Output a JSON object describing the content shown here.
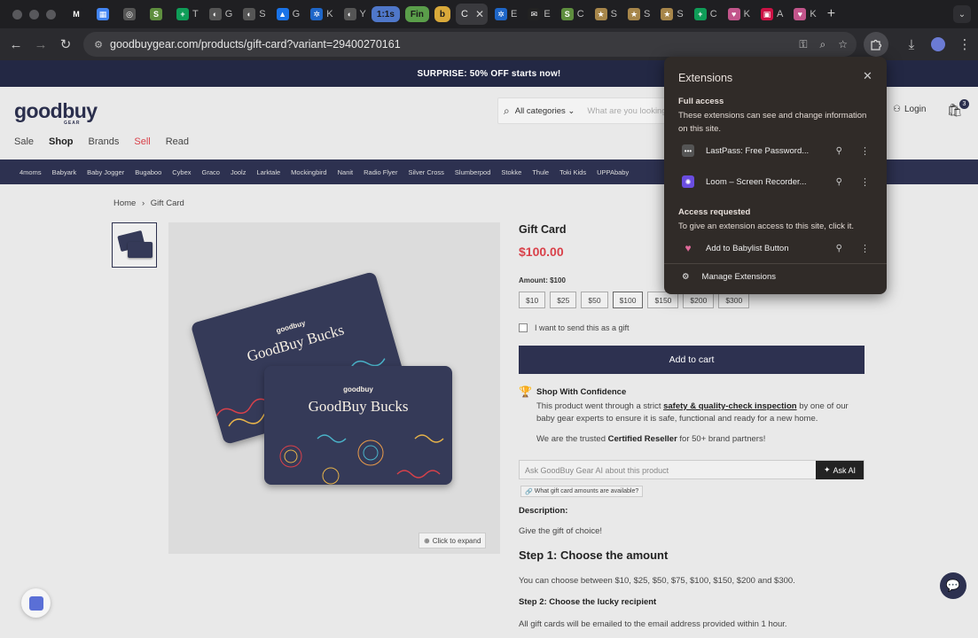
{
  "tabs": [
    {
      "label": "",
      "icon": "gmail-icon",
      "color": "#1f1f22",
      "glyph": "M",
      "active": false
    },
    {
      "label": "",
      "icon": "calendar-icon",
      "color": "#4285f4",
      "glyph": "▦",
      "active": false
    },
    {
      "label": "",
      "icon": "openai-icon",
      "color": "#555",
      "glyph": "◎",
      "active": false
    },
    {
      "label": "",
      "icon": "shopify-icon",
      "color": "#5e8e3e",
      "glyph": "S",
      "active": false
    },
    {
      "label": "T",
      "icon": "sheets-icon",
      "color": "#0f9d58",
      "glyph": "+",
      "active": false
    },
    {
      "label": "G",
      "icon": "github-icon",
      "color": "#555",
      "glyph": "◐",
      "active": false
    },
    {
      "label": "S",
      "icon": "github-icon",
      "color": "#555",
      "glyph": "◐",
      "active": false
    },
    {
      "label": "G",
      "icon": "drive-icon",
      "color": "#1a73e8",
      "glyph": "▲",
      "active": false
    },
    {
      "label": "K",
      "icon": "gear-icon",
      "color": "#1e66c8",
      "glyph": "✲",
      "active": false
    },
    {
      "label": "Y",
      "icon": "github-icon",
      "color": "#555",
      "glyph": "◐",
      "active": false
    },
    {
      "label": "1:1s",
      "icon": "pill",
      "color": "#4f77c9",
      "glyph": "",
      "active": false
    },
    {
      "label": "Fin",
      "icon": "pill",
      "color": "#5a9e4a",
      "glyph": "",
      "active": false
    },
    {
      "label": "b",
      "icon": "pill",
      "color": "#d9a93a",
      "glyph": "",
      "active": false
    },
    {
      "label": "C",
      "icon": "active-tab",
      "color": "#3a3a3e",
      "glyph": "",
      "active": true
    },
    {
      "label": "E",
      "icon": "gear-icon",
      "color": "#1e66c8",
      "glyph": "✲",
      "active": false
    },
    {
      "label": "E",
      "icon": "email-icon",
      "color": "#222",
      "glyph": "✉",
      "active": false
    },
    {
      "label": "C",
      "icon": "shopify-icon",
      "color": "#5e8e3e",
      "glyph": "S",
      "active": false
    },
    {
      "label": "S",
      "icon": "star-icon",
      "color": "#a7864a",
      "glyph": "★",
      "active": false
    },
    {
      "label": "S",
      "icon": "star-icon",
      "color": "#a7864a",
      "glyph": "★",
      "active": false
    },
    {
      "label": "S",
      "icon": "star-icon",
      "color": "#a7864a",
      "glyph": "★",
      "active": false
    },
    {
      "label": "C",
      "icon": "sheets-icon",
      "color": "#0f9d58",
      "glyph": "+",
      "active": false
    },
    {
      "label": "K",
      "icon": "heart-icon",
      "color": "#c2558b",
      "glyph": "♥",
      "active": false
    },
    {
      "label": "A",
      "icon": "image-icon",
      "color": "#c14",
      "glyph": "▣",
      "active": false
    },
    {
      "label": "K",
      "icon": "heart-icon",
      "color": "#c2558b",
      "glyph": "♥",
      "active": false
    }
  ],
  "url": "goodbuygear.com/products/gift-card?variant=29400270161",
  "promo": "SURPRISE: 50% OFF starts now!",
  "logo": {
    "text": "goodbuy",
    "sub": "GEAR"
  },
  "search": {
    "category": "All categories",
    "placeholder": "What are you looking"
  },
  "login": "Login",
  "cart_count": "3",
  "mainnav": [
    {
      "label": "Sale",
      "style": ""
    },
    {
      "label": "Shop",
      "style": "bold"
    },
    {
      "label": "Brands",
      "style": ""
    },
    {
      "label": "Sell",
      "style": "sell"
    },
    {
      "label": "Read",
      "style": ""
    }
  ],
  "brands": [
    "4moms",
    "Babyark",
    "Baby Jogger",
    "Bugaboo",
    "Cybex",
    "Graco",
    "Joolz",
    "Larktale",
    "Mockingbird",
    "Nanit",
    "Radio Flyer",
    "Silver Cross",
    "Slumberpod",
    "Stokke",
    "Thule",
    "Toki Kids",
    "UPPAbaby"
  ],
  "breadcrumb": {
    "home": "Home",
    "sep": "›",
    "current": "Gift Card"
  },
  "image": {
    "expand": "Click to expand",
    "card_logo": "goodbuy",
    "card_text": "GoodBuy Bucks"
  },
  "product": {
    "title": "Gift Card",
    "price": "$100.00",
    "amount_label": "Amount: $100",
    "amounts": [
      "$10",
      "$25",
      "$50",
      "$100",
      "$150",
      "$200",
      "$300"
    ],
    "selected_amount": "$100",
    "gift_label": "I want to send this as a gift",
    "add_to_cart": "Add to cart"
  },
  "confidence": {
    "heading": "Shop With Confidence",
    "line1_pre": "This product went through a strict ",
    "line1_link": "safety & quality-check inspection",
    "line1_post": " by one of",
    "line2": "our baby gear experts to ensure it is safe, functional and ready for a new home.",
    "line3_pre": "We are the trusted ",
    "line3_bold": "Certified Reseller",
    "line3_post": " for 50+ brand partners!"
  },
  "ask_ai": {
    "placeholder": "Ask GoodBuy Gear AI about this product",
    "button": "Ask AI",
    "suggestion": "What gift card amounts are available?"
  },
  "description": {
    "heading": "Description:",
    "text": "Give the gift of choice!",
    "step1": "Step 1: Choose the amount",
    "step1_text": "You can choose between $10, $25, $50, $75, $100, $150, $200 and $300.",
    "step2": "Step 2: Choose the lucky recipient",
    "step2_text": "All gift cards will be emailed to the email address provided within 1 hour."
  },
  "extensions": {
    "title": "Extensions",
    "full_access": "Full access",
    "full_access_desc": "These extensions can see and change information on this site.",
    "items": [
      {
        "name": "LastPass: Free Password...",
        "icon": "lastpass-icon",
        "color": "#555"
      },
      {
        "name": "Loom – Screen Recorder...",
        "icon": "loom-icon",
        "color": "#6a4de0"
      }
    ],
    "requested": "Access requested",
    "requested_desc": "To give an extension access to this site, click it.",
    "requested_items": [
      {
        "name": "Add to Babylist Button",
        "icon": "heart-icon",
        "color": "#e06a9a"
      }
    ],
    "manage": "Manage Extensions"
  },
  "colors": {
    "brand": "#2d3150",
    "sale": "#d9414a",
    "popup_bg": "#302b28"
  }
}
